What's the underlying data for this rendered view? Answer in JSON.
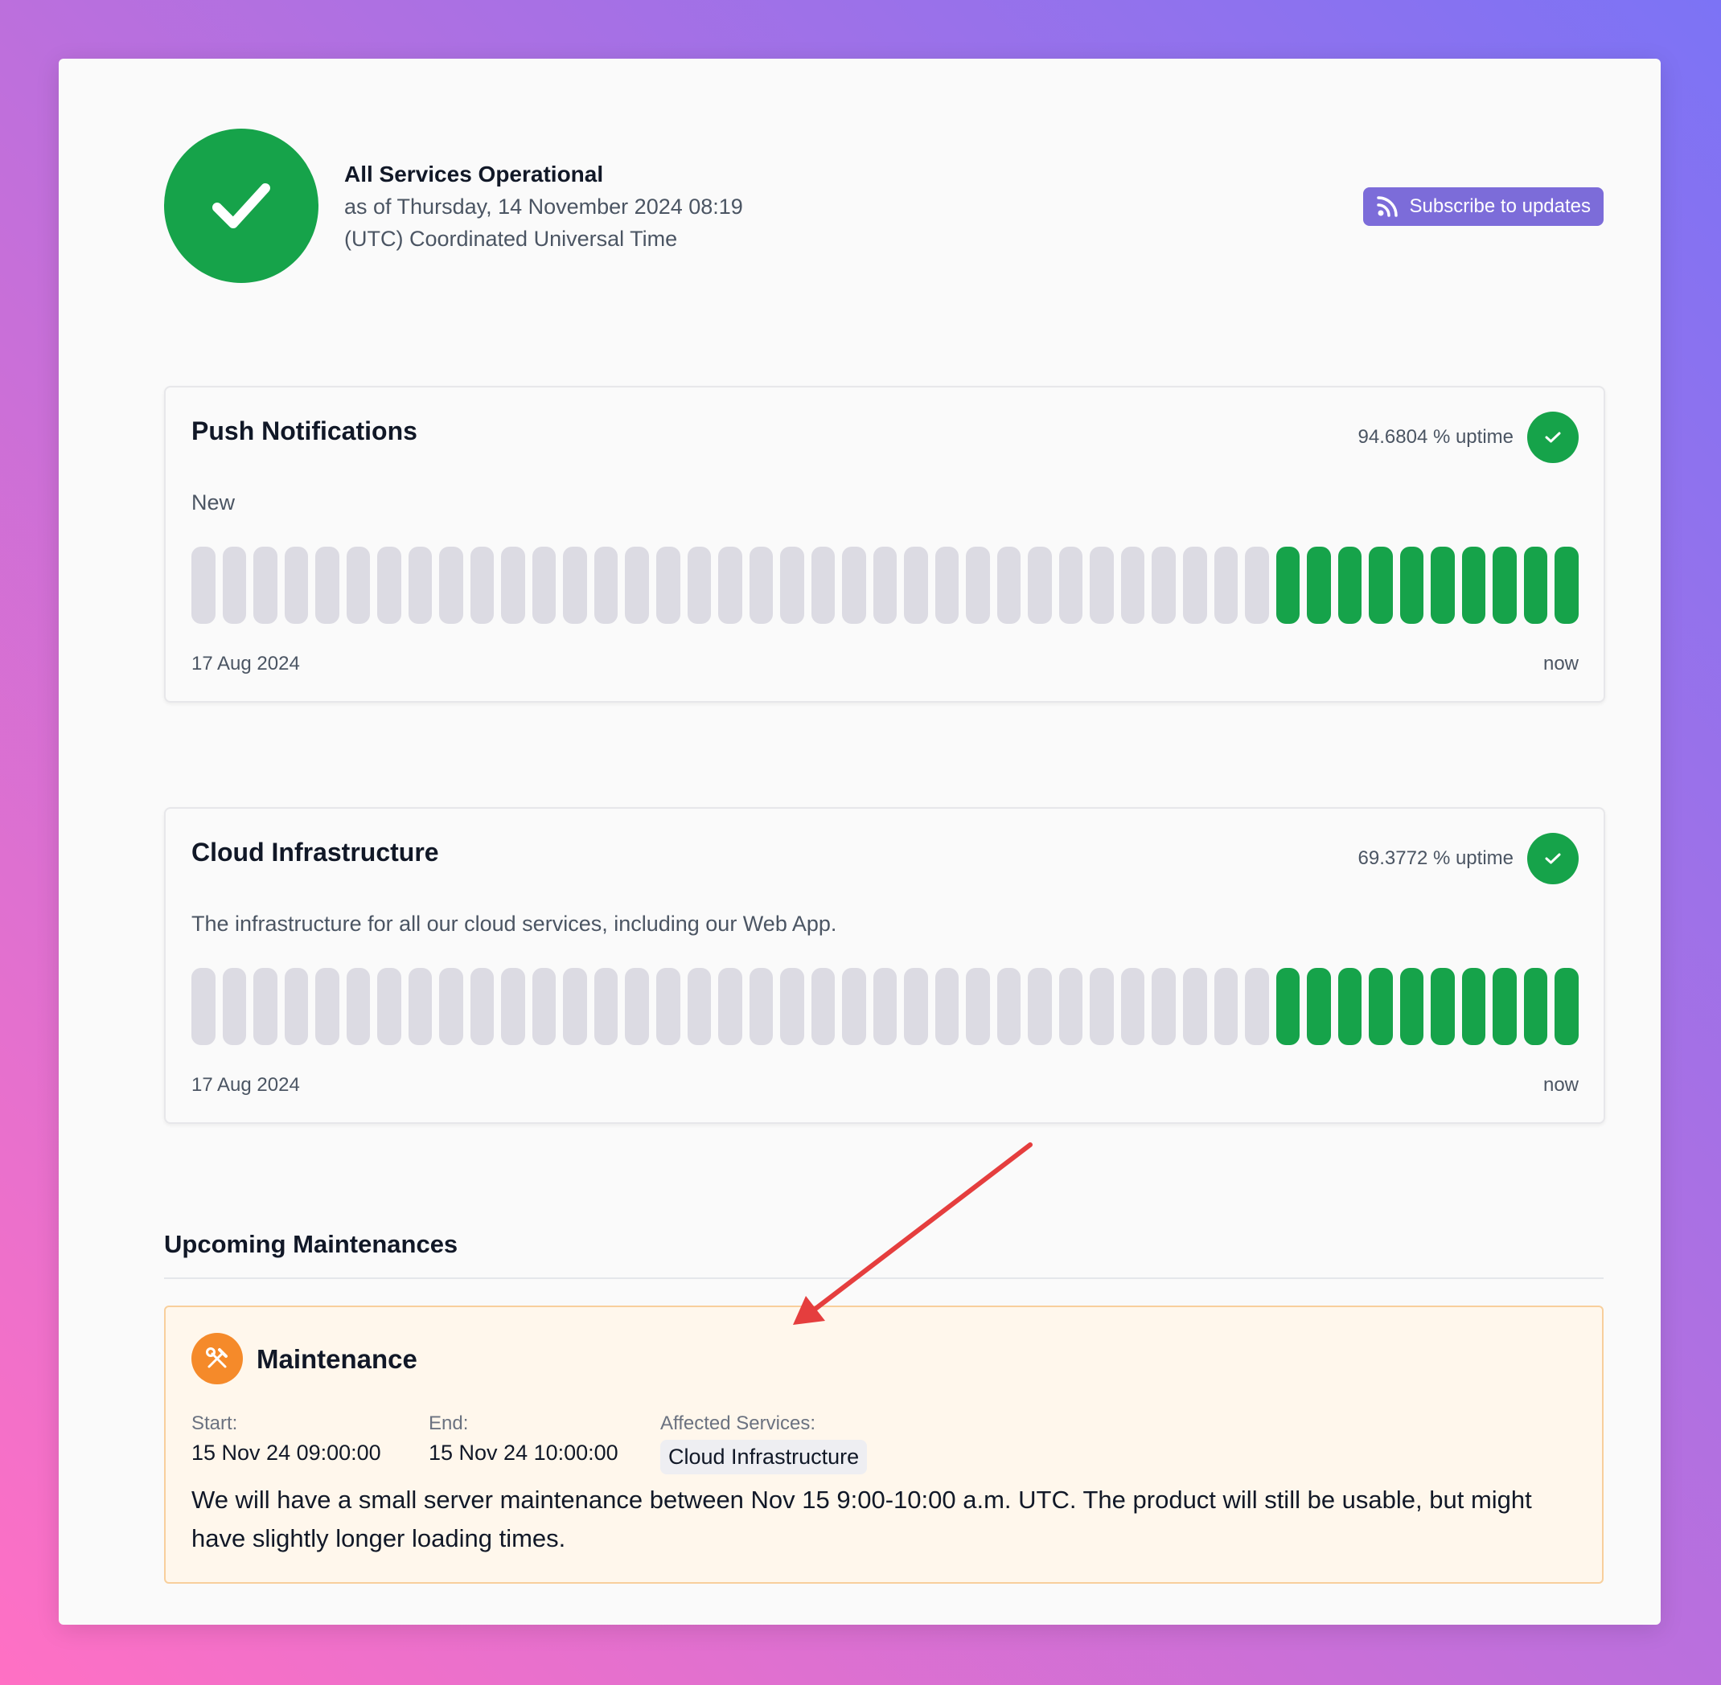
{
  "header": {
    "status_title": "All Services Operational",
    "status_time": "as of Thursday, 14 November 2024 08:19",
    "status_timezone": "(UTC) Coordinated Universal Time",
    "subscribe_label": "Subscribe to updates"
  },
  "services": [
    {
      "name": "Push Notifications",
      "uptime": "94.6804 % uptime",
      "description": "New",
      "range_start": "17 Aug 2024",
      "range_end": "now"
    },
    {
      "name": "Cloud Infrastructure",
      "uptime": "69.3772 % uptime",
      "description": "The infrastructure for all our cloud services, including our Web App.",
      "range_start": "17 Aug 2024",
      "range_end": "now"
    }
  ],
  "maintenances": {
    "section_title": "Upcoming Maintenances",
    "item": {
      "title": "Maintenance",
      "start_label": "Start:",
      "start_value": "15 Nov 24 09:00:00",
      "end_label": "End:",
      "end_value": "15 Nov 24 10:00:00",
      "affected_label": "Affected Services:",
      "affected_service": "Cloud Infrastructure",
      "message": "We will have a small server maintenance between Nov 15 9:00-10:00 a.m. UTC. The product will still be usable, but might have slightly longer loading times."
    }
  },
  "colors": {
    "operational": "#16a34a",
    "no_data": "#dcdbe3",
    "accent": "#7c6cd9",
    "maintenance": "#f58a2a",
    "annotation_arrow": "#e53e3e"
  }
}
